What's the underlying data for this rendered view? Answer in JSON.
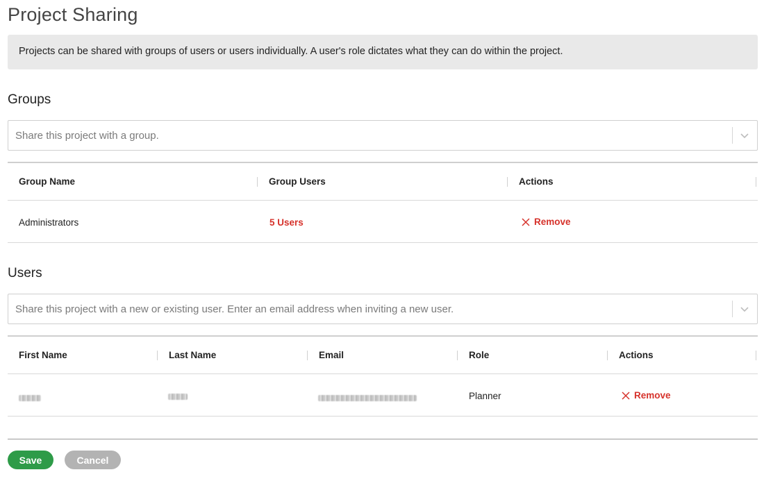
{
  "page": {
    "title": "Project Sharing",
    "info": "Projects can be shared with groups of users or users individually. A user's role dictates what they can do within the project."
  },
  "groups": {
    "heading": "Groups",
    "select_placeholder": "Share this project with a group.",
    "columns": [
      "Group Name",
      "Group Users",
      "Actions"
    ],
    "rows": [
      {
        "name": "Administrators",
        "users": "5 Users",
        "action": "Remove"
      }
    ]
  },
  "users": {
    "heading": "Users",
    "select_placeholder": "Share this project with a new or existing user. Enter an email address when inviting a new user.",
    "columns": [
      "First Name",
      "Last Name",
      "Email",
      "Role",
      "Actions"
    ],
    "rows": [
      {
        "first_name": "",
        "last_name": "",
        "email": "",
        "role": "Planner",
        "action": "Remove"
      }
    ]
  },
  "footer": {
    "save_label": "Save",
    "cancel_label": "Cancel"
  },
  "colors": {
    "accent_red": "#d6322b",
    "save_green": "#2e9b48",
    "cancel_gray": "#b3b3b3",
    "info_bg": "#e9e9e9"
  },
  "icons": [
    "chevron-down-icon",
    "close-icon"
  ]
}
